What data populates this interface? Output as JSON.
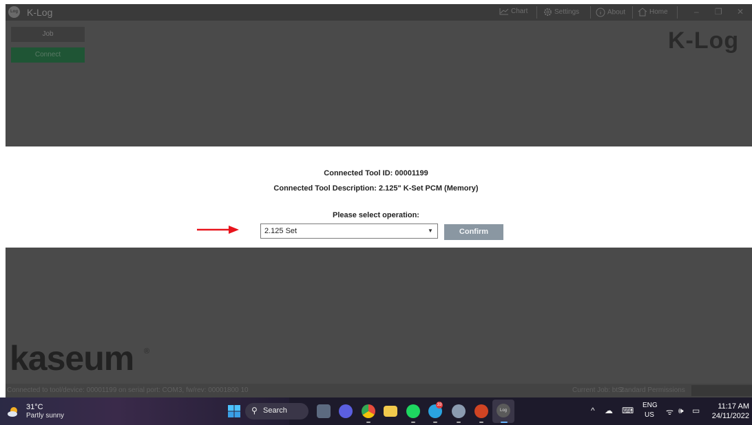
{
  "app": {
    "title": "K-Log",
    "logo_text": "Log",
    "nav": [
      {
        "label": "Chart",
        "icon": "chart-icon"
      },
      {
        "label": "Settings",
        "icon": "gear-icon"
      },
      {
        "label": "About",
        "icon": "info-icon"
      },
      {
        "label": "Home",
        "icon": "home-icon"
      }
    ],
    "brand_large": "K-Log",
    "buttons": {
      "job": "Job",
      "connect": "Connect"
    }
  },
  "dialog": {
    "tool_id": "Connected Tool ID: 00001199",
    "tool_desc": "Connected Tool Description: 2.125\" K-Set PCM (Memory)",
    "prompt": "Please select operation:",
    "selected_operation": "2.125 Set",
    "confirm_label": "Confirm"
  },
  "brand_footer": {
    "name": "kaseum",
    "reg": "®"
  },
  "statusbar": {
    "connection": "Connected to tool/device: 00001199 on serial port: COM3, fw/rev: 00001800 10",
    "current_job": "Current Job: bt 2",
    "permissions": "Standard Permissions"
  },
  "taskbar": {
    "weather_temp": "31°C",
    "weather_desc": "Partly sunny",
    "search_label": "Search",
    "telegram_badge": "33",
    "app_log_label": "Log",
    "lang_line1": "ENG",
    "lang_line2": "US",
    "time": "11:17 AM",
    "date": "24/11/2022"
  },
  "colors": {
    "connect_green": "#1f5535",
    "confirm_button": "#8a97a2",
    "arrow_red": "#e8141c"
  }
}
